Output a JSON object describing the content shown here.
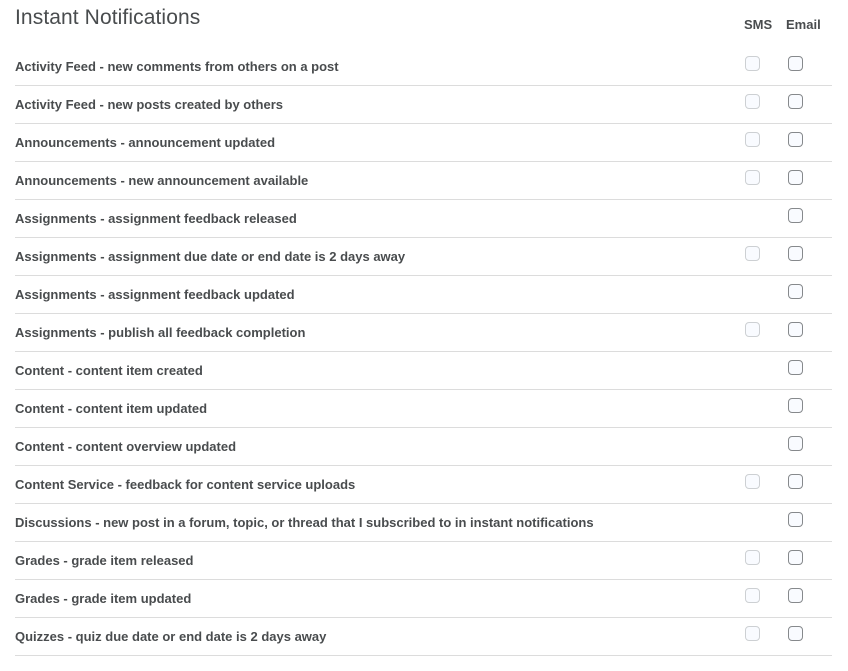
{
  "header": {
    "title": "Instant Notifications",
    "columns": {
      "sms": "SMS",
      "email": "Email"
    }
  },
  "rows": [
    {
      "label": "Activity Feed - new comments from others on a post",
      "sms": true,
      "email": true
    },
    {
      "label": "Activity Feed - new posts created by others",
      "sms": true,
      "email": true
    },
    {
      "label": "Announcements - announcement updated",
      "sms": true,
      "email": true
    },
    {
      "label": "Announcements - new announcement available",
      "sms": true,
      "email": true
    },
    {
      "label": "Assignments - assignment feedback released",
      "sms": false,
      "email": true
    },
    {
      "label": "Assignments - assignment due date or end date is 2 days away",
      "sms": true,
      "email": true
    },
    {
      "label": "Assignments - assignment feedback updated",
      "sms": false,
      "email": true
    },
    {
      "label": "Assignments - publish all feedback completion",
      "sms": true,
      "email": true
    },
    {
      "label": "Content - content item created",
      "sms": false,
      "email": true
    },
    {
      "label": "Content - content item updated",
      "sms": false,
      "email": true
    },
    {
      "label": "Content - content overview updated",
      "sms": false,
      "email": true
    },
    {
      "label": "Content Service - feedback for content service uploads",
      "sms": true,
      "email": true
    },
    {
      "label": "Discussions - new post in a forum, topic, or thread that I subscribed to in instant notifications",
      "sms": false,
      "email": true
    },
    {
      "label": "Grades - grade item released",
      "sms": true,
      "email": true
    },
    {
      "label": "Grades - grade item updated",
      "sms": true,
      "email": true
    },
    {
      "label": "Quizzes - quiz due date or end date is 2 days away",
      "sms": true,
      "email": true
    }
  ],
  "state": {
    "sms_checked": false,
    "sms_disabled": true,
    "email_checked": false
  },
  "colors": {
    "text": "#494c4e",
    "divider": "#dcdcdc",
    "checkbox_bg": "#f9fbff",
    "checkbox_border": "#86898c",
    "checkbox_disabled_border": "#cdd0d3"
  }
}
